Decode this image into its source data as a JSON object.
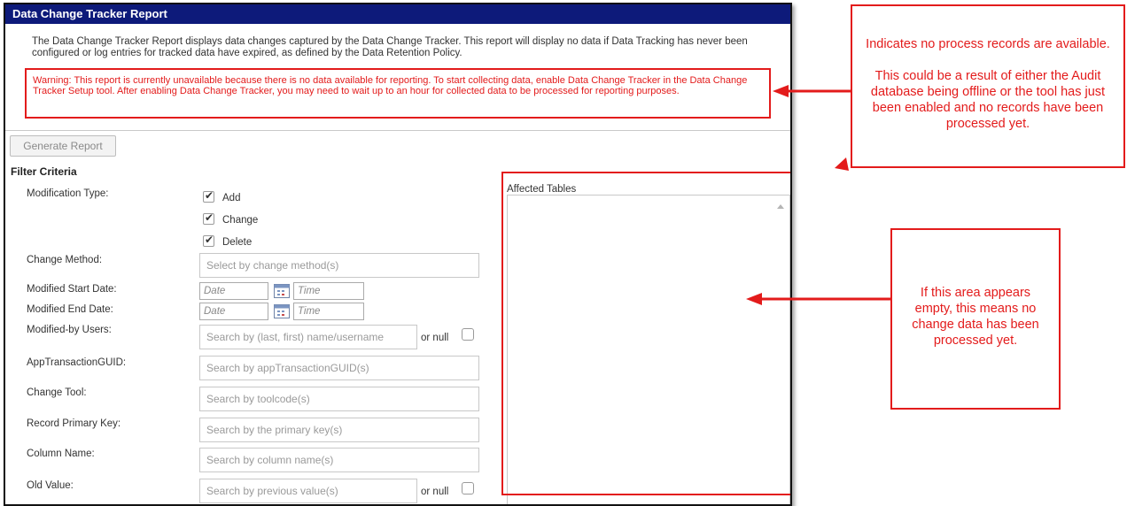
{
  "window": {
    "title": "Data Change Tracker Report",
    "description": "The Data Change Tracker Report displays data changes captured by the Data Change Tracker. This report will display no data if Data Tracking has never been configured or log entries for tracked data have expired, as defined by the Data Retention Policy.",
    "warning": "Warning: This report is currently unavailable because there is no data available for reporting. To start collecting data, enable Data Change Tracker in the Data Change Tracker Setup tool. After enabling Data Change Tracker, you may need to wait up to an hour for collected data to be processed for reporting purposes."
  },
  "toolbar": {
    "generate_label": "Generate Report"
  },
  "filter": {
    "title": "Filter Criteria",
    "modification_type_label": "Modification Type:",
    "modification_types": [
      "Add",
      "Change",
      "Delete"
    ],
    "change_method_label": "Change Method:",
    "change_method_placeholder": "Select by change method(s)",
    "start_date_label": "Modified Start Date:",
    "end_date_label": "Modified End Date:",
    "date_placeholder": "Date",
    "time_placeholder": "Time",
    "users_label": "Modified-by Users:",
    "users_placeholder": "Search by (last, first) name/username",
    "or_null_label": "or null",
    "guid_label": "AppTransactionGUID:",
    "guid_placeholder": "Search by appTransactionGUID(s)",
    "tool_label": "Change Tool:",
    "tool_placeholder": "Search by toolcode(s)",
    "pk_label": "Record Primary Key:",
    "pk_placeholder": "Search by the primary key(s)",
    "column_label": "Column Name:",
    "column_placeholder": "Search by column name(s)",
    "old_value_label": "Old Value:",
    "old_value_placeholder": "Search by previous value(s)"
  },
  "affected_tables": {
    "label": "Affected Tables"
  },
  "annotations": {
    "top": "Indicates no process records are available.\n\nThis could be a result of either the Audit database being offline or the tool has just been enabled and no records have been processed yet.",
    "side": "If this area appears empty, this means no change data has been processed yet.",
    "color": "#e31b1b"
  }
}
